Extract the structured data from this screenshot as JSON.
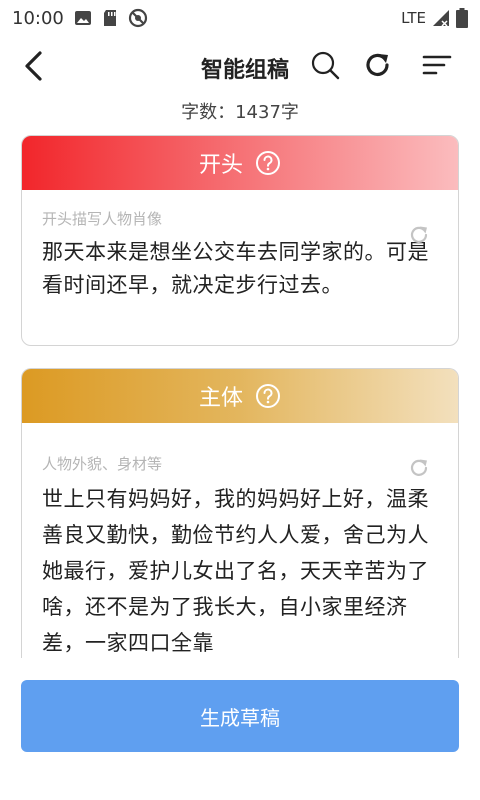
{
  "status_bar": {
    "time": "10:00",
    "network": "LTE"
  },
  "header": {
    "title": "智能组稿"
  },
  "word_count": "字数：1437字",
  "sections": {
    "opening": {
      "title": "开头",
      "hint": "开头描写人物肖像",
      "text": "那天本来是想坐公交车去同学家的。可是看时间还早，就决定步行过去。",
      "gradient": [
        "#f2262b",
        "#fbbcbe"
      ]
    },
    "body": {
      "title": "主体",
      "hint": "人物外貌、身材等",
      "text": "世上只有妈妈好，我的妈妈好上好，温柔善良又勤快，勤俭节约人人爱，舍己为人她最行，爱护儿女出了名，天天辛苦为了啥，还不是为了我长大，自小家里经济差，一家四口全靠",
      "gradient": [
        "#dc9a23",
        "#f3e0bd"
      ]
    }
  },
  "actions": {
    "generate_label": "生成草稿",
    "accent": "#5f9ff0"
  },
  "icons": {
    "back": "chevron-left-icon",
    "search": "search-icon",
    "refresh": "refresh-icon",
    "menu": "sort-menu-icon",
    "help": "help-circle-icon",
    "regenerate": "regenerate-icon"
  }
}
